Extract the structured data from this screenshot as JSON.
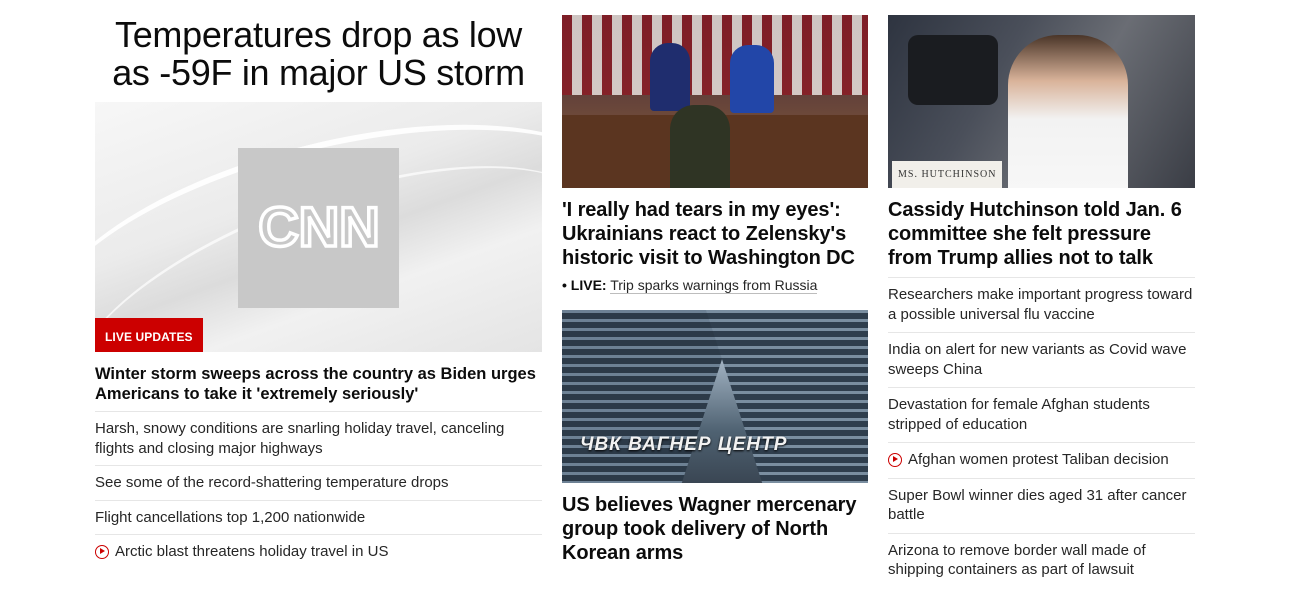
{
  "col1": {
    "headline": "Temperatures drop as low as -59F in major US storm",
    "logo_text": "CNN",
    "badge": "LIVE UPDATES",
    "lead": "Winter storm sweeps across the country as Biden urges Americans to take it 'extremely seriously'",
    "items": [
      {
        "text": "Harsh, snowy conditions are snarling holiday travel, canceling flights and closing major highways",
        "video": false
      },
      {
        "text": "See some of the record-shattering temperature drops",
        "video": false
      },
      {
        "text": "Flight cancellations top 1,200 nationwide",
        "video": false
      },
      {
        "text": "Arctic blast threatens holiday travel in US",
        "video": true
      }
    ]
  },
  "col2": {
    "story1": {
      "headline": "'I really had tears in my eyes': Ukrainians react to Zelensky's historic visit to Washington DC",
      "live_tag": "• LIVE:",
      "live_text": "Trip sparks warnings from Russia"
    },
    "story2": {
      "sign_text": "ЧВК ВАГНЕР ЦЕНТР",
      "headline": "US believes Wagner mercenary group took delivery of North Korean arms"
    }
  },
  "col3": {
    "plate_text": "MS. HUTCHINSON",
    "headline": "Cassidy Hutchinson told Jan. 6 committee she felt pressure from Trump allies not to talk",
    "items": [
      {
        "text": "Researchers make important progress toward a possible universal flu vaccine",
        "video": false
      },
      {
        "text": "India on alert for new variants as Covid wave sweeps China",
        "video": false
      },
      {
        "text": "Devastation for female Afghan students stripped of education",
        "video": false
      },
      {
        "text": "Afghan women protest Taliban decision",
        "video": true
      },
      {
        "text": "Super Bowl winner dies aged 31 after cancer battle",
        "video": false
      },
      {
        "text": "Arizona to remove border wall made of shipping containers as part of lawsuit",
        "video": false
      }
    ]
  },
  "colors": {
    "accent_red": "#cc0000",
    "text": "#0c0c0c",
    "divider": "#e6e6e6"
  }
}
